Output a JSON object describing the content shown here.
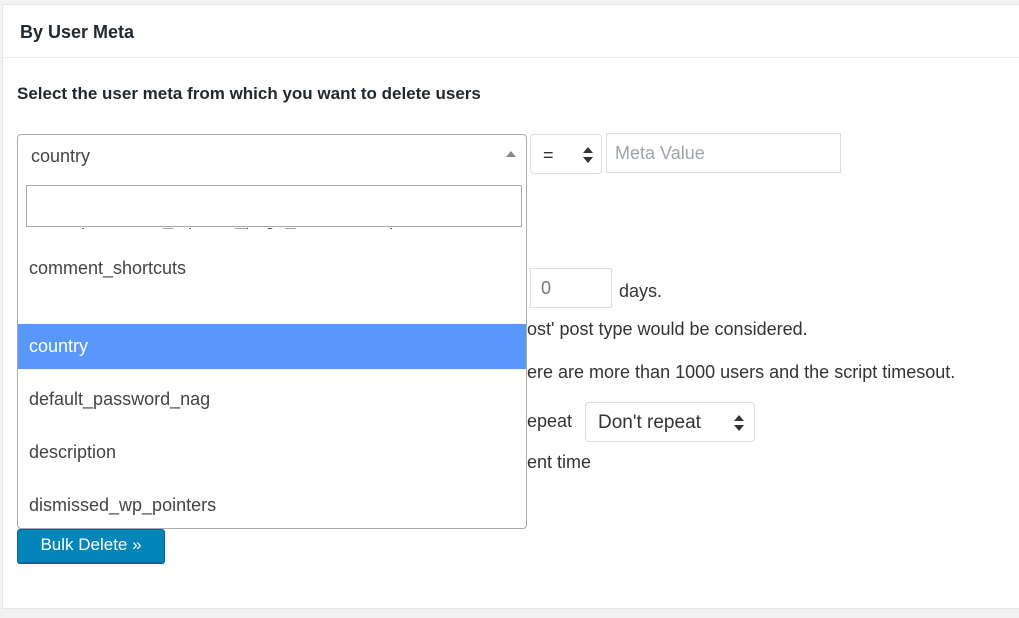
{
  "panel": {
    "title": "By User Meta",
    "heading": "Select the user meta from which you want to delete users"
  },
  "meta_select": {
    "selected": "country"
  },
  "operator": {
    "selected": "="
  },
  "meta_value": {
    "placeholder": "Meta Value",
    "value": ""
  },
  "days_filter": {
    "value": "0",
    "suffix": "days."
  },
  "partial_texts": {
    "post_type_note": "ost' post type would be considered.",
    "timeout_note": "ere are more than 1000 users and the script timesout.",
    "repeat_label": "epeat",
    "time_label": "ent time"
  },
  "repeat_select": {
    "selected": "Don't repeat"
  },
  "bulk_delete_button": "Bulk Delete »",
  "dropdown": {
    "search_value": "",
    "items": [
      "closedpostboxes_toplevel_page_bulk-delete-posts",
      "comment_shortcuts",
      "country",
      "default_password_nag",
      "description",
      "dismissed_wp_pointers"
    ],
    "highlighted": "country"
  },
  "colors": {
    "highlight": "#5897fb",
    "primary_button": "#0085ba"
  }
}
